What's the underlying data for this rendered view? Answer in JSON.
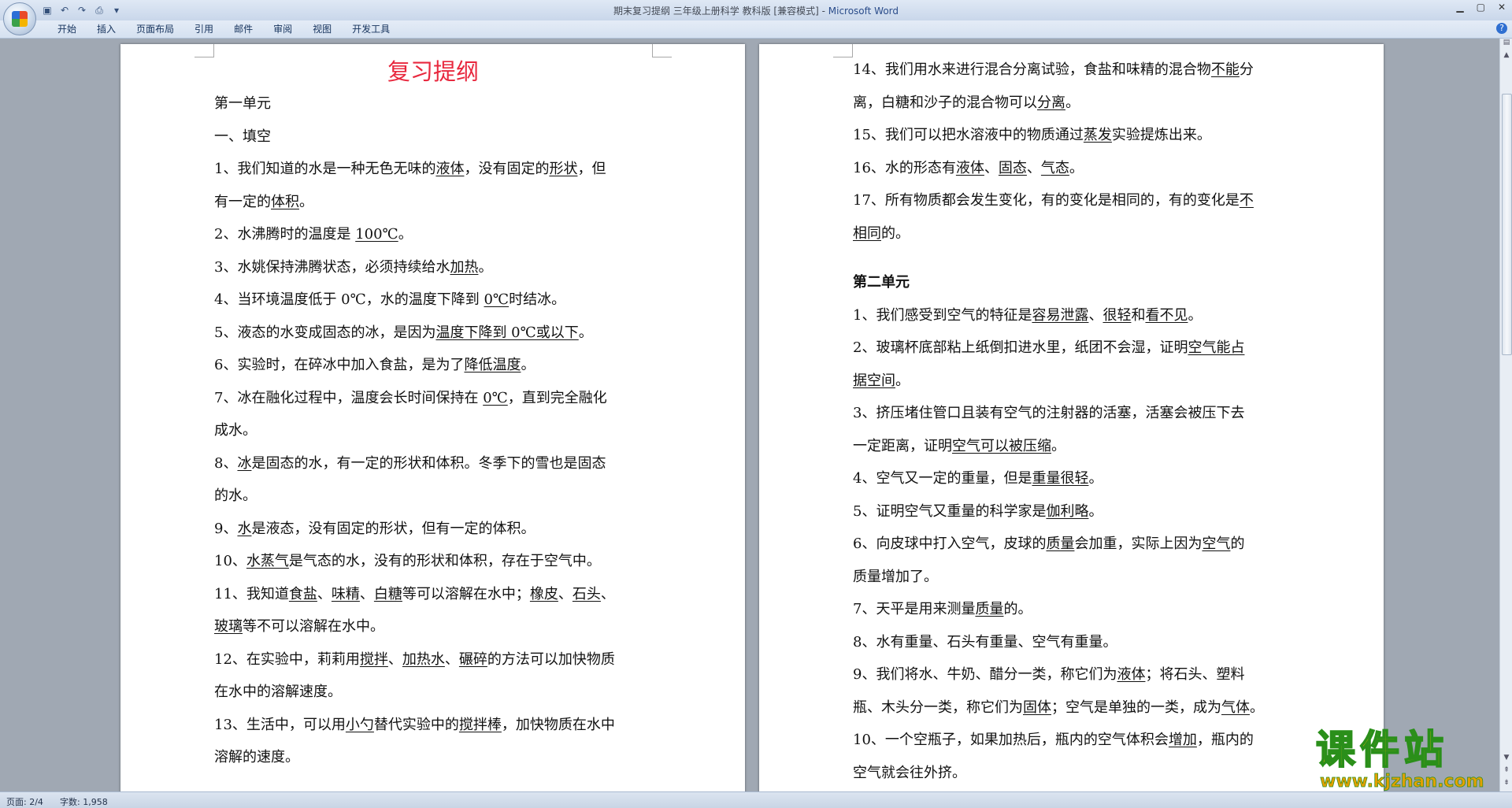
{
  "window": {
    "title": "期末复习提纲 三年级上册科学 教科版 [兼容模式]",
    "app_name": "Microsoft Word",
    "separator": " - "
  },
  "quick_access": [
    "save-icon",
    "undo-icon",
    "redo-icon",
    "print-preview-icon"
  ],
  "ribbon_tabs": [
    "开始",
    "插入",
    "页面布局",
    "引用",
    "邮件",
    "审阅",
    "视图",
    "开发工具"
  ],
  "doc": {
    "title": "复习提纲",
    "left": [
      {
        "t": "第一单元"
      },
      {
        "t": "一、填空"
      },
      {
        "t": "1、我们知道的水是一种无色无味的<u>液体</u>，没有固定的<u>形状</u>，但"
      },
      {
        "t": "有一定的<u>体积</u>。"
      },
      {
        "t": "2、水沸腾时的温度是 <u>100℃</u>。"
      },
      {
        "t": "3、水姚保持沸腾状态，必须持续给水<u>加热</u>。"
      },
      {
        "t": "4、当环境温度低于 0℃，水的温度下降到 <u>0℃</u>时结冰。"
      },
      {
        "t": "5、液态的水变成固态的冰，是因为<u>温度下降到 0℃或以下</u>。"
      },
      {
        "t": "6、实验时，在碎冰中加入食盐，是为了<u>降低温度</u>。"
      },
      {
        "t": "7、冰在融化过程中，温度会长时间保持在 <u>0℃</u>，直到完全融化"
      },
      {
        "t": "成水。"
      },
      {
        "t": "8、<u>冰</u>是固态的水，有一定的形状和体积。冬季下的雪也是固态"
      },
      {
        "t": "的水。"
      },
      {
        "t": "9、<u>水</u>是液态，没有固定的形状，但有一定的体积。"
      },
      {
        "t": "10、<u>水蒸气</u>是气态的水，没有的形状和体积，存在于空气中。"
      },
      {
        "t": "11、我知道<u>食盐</u>、<u>味精</u>、<u>白糖</u>等可以溶解在水中；<u>橡皮</u>、<u>石头</u>、"
      },
      {
        "t": "<u>玻璃</u>等不可以溶解在水中。"
      },
      {
        "t": "12、在实验中，莉莉用<u>搅拌</u>、<u>加热水</u>、<u>碾碎</u>的方法可以加快物质"
      },
      {
        "t": "在水中的溶解速度。"
      },
      {
        "t": "13、生活中，可以用<u>小勺</u>替代实验中的<u>搅拌棒</u>，加快物质在水中"
      },
      {
        "t": "溶解的速度。"
      }
    ],
    "right": [
      {
        "t": "14、我们用水来进行混合分离试验，食盐和味精的混合物<u>不能</u>分"
      },
      {
        "t": "离，白糖和沙子的混合物可以<u>分离</u>。"
      },
      {
        "t": "15、我们可以把水溶液中的物质通过<u>蒸发</u>实验提炼出来。"
      },
      {
        "t": "16、水的形态有<u>液体</u>、<u>固态</u>、<u>气态</u>。"
      },
      {
        "t": "17、所有物质都会发生变化，有的变化是相同的，有的变化是<u>不</u>"
      },
      {
        "t": "<u>相同</u>的。"
      },
      {
        "t": "第二单元",
        "head": true
      },
      {
        "t": "1、我们感受到空气的特征是<u>容易泄露</u>、<u>很轻</u>和<u>看不见</u>。"
      },
      {
        "t": "2、玻璃杯底部粘上纸倒扣进水里，纸团不会湿，证明<u>空气能占</u>"
      },
      {
        "t": "<u>据空间</u>。"
      },
      {
        "t": "3、挤压堵住管口且装有空气的注射器的活塞，活塞会被压下去"
      },
      {
        "t": "一定距离，证明<u>空气可以被压缩</u>。"
      },
      {
        "t": "4、空气又一定的重量，但是<u>重量很轻</u>。"
      },
      {
        "t": "5、证明空气又重量的科学家是<u>伽利略</u>。"
      },
      {
        "t": "6、向皮球中打入空气，皮球的<u>质量</u>会加重，实际上因为<u>空气</u>的"
      },
      {
        "t": "质量增加了。"
      },
      {
        "t": "7、天平是用来测量<u>质量</u>的。"
      },
      {
        "t": "8、水有重量、石头有重量、空气有重量。"
      },
      {
        "t": "9、我们将水、牛奶、醋分一类，称它们为<u>液体</u>；将石头、塑料"
      },
      {
        "t": "瓶、木头分一类，称它们为<u>固体</u>；空气是单独的一类，成为<u>气体</u>。"
      },
      {
        "t": "10、一个空瓶子，如果加热后，瓶内的空气体积会<u>增加</u>，瓶内的"
      },
      {
        "t": "空气就会往外挤。"
      }
    ]
  },
  "status": {
    "page": "页面: 2/4",
    "words": "字数: 1,958"
  },
  "watermark": {
    "text": "课件站",
    "url": "www.kjzhan.com"
  }
}
